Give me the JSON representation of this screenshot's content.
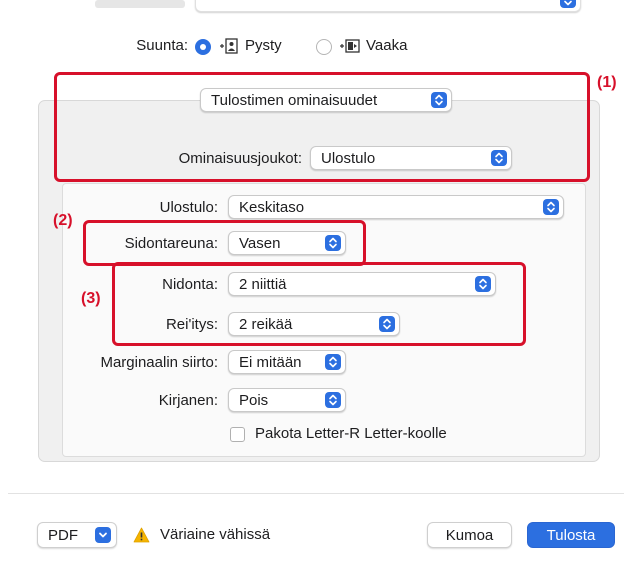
{
  "orientation": {
    "label": "Suunta:",
    "portrait": "Pysty",
    "landscape": "Vaaka",
    "selected": "Pysty"
  },
  "panel_menu": {
    "value": "Tulostimen ominaisuudet"
  },
  "feature_sets": {
    "label": "Ominaisuusjoukot:",
    "value": "Ulostulo"
  },
  "output": {
    "label": "Ulostulo:",
    "value": "Keskitaso"
  },
  "binding_edge": {
    "label": "Sidontareuna:",
    "value": "Vasen"
  },
  "stapling": {
    "label": "Nidonta:",
    "value": "2 niittiä"
  },
  "punching": {
    "label": "Rei'itys:",
    "value": "2 reikää"
  },
  "margin_shift": {
    "label": "Marginaalin siirto:",
    "value": "Ei mitään"
  },
  "booklet": {
    "label": "Kirjanen:",
    "value": "Pois"
  },
  "force_letter": {
    "label": "Pakota Letter-R Letter-koolle",
    "checked": false
  },
  "callouts": {
    "one": "(1)",
    "two": "(2)",
    "three": "(3)"
  },
  "footer": {
    "pdf": "PDF",
    "warning": "Väriaine vähissä",
    "cancel": "Kumoa",
    "print": "Tulosta"
  },
  "colors": {
    "accent": "#2c6fe0",
    "highlight": "#d7102a",
    "warning": "#f5b400"
  },
  "icons": {
    "portrait": "portrait-orientation-icon",
    "landscape": "landscape-orientation-icon",
    "warning": "warning-triangle-icon",
    "stepper": "up-down-chevron-icon",
    "dropdown": "chevron-down-icon"
  }
}
